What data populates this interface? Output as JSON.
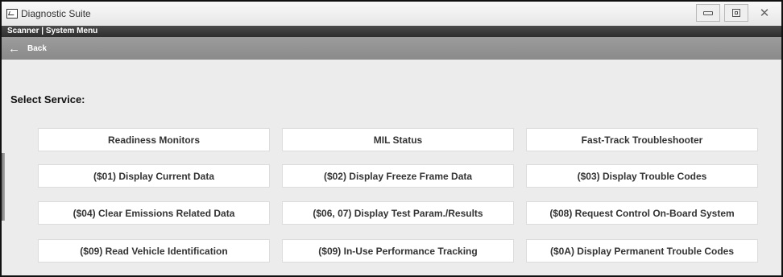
{
  "window": {
    "title": "Diagnostic Suite",
    "controls": [
      {
        "name": "minimize-button",
        "icon": "minimize-icon"
      },
      {
        "name": "maximize-button",
        "icon": "maximize-icon"
      },
      {
        "name": "close-button",
        "icon": "close-icon",
        "glyph": "✕"
      }
    ]
  },
  "menubar": {
    "path": "Scanner | System Menu"
  },
  "backbar": {
    "arrow_glyph": "←",
    "label": "Back"
  },
  "main": {
    "select_label": "Select Service:",
    "services": [
      [
        "Readiness Monitors",
        "MIL Status",
        "Fast-Track Troubleshooter"
      ],
      [
        "($01) Display Current Data",
        "($02) Display Freeze Frame Data",
        "($03) Display Trouble Codes"
      ],
      [
        "($04) Clear Emissions Related Data",
        "($06, 07) Display Test Param./Results",
        "($08) Request Control On-Board System"
      ],
      [
        "($09) Read Vehicle Identification",
        "($09) In-Use Performance Tracking",
        "($0A) Display Permanent Trouble Codes"
      ]
    ]
  }
}
